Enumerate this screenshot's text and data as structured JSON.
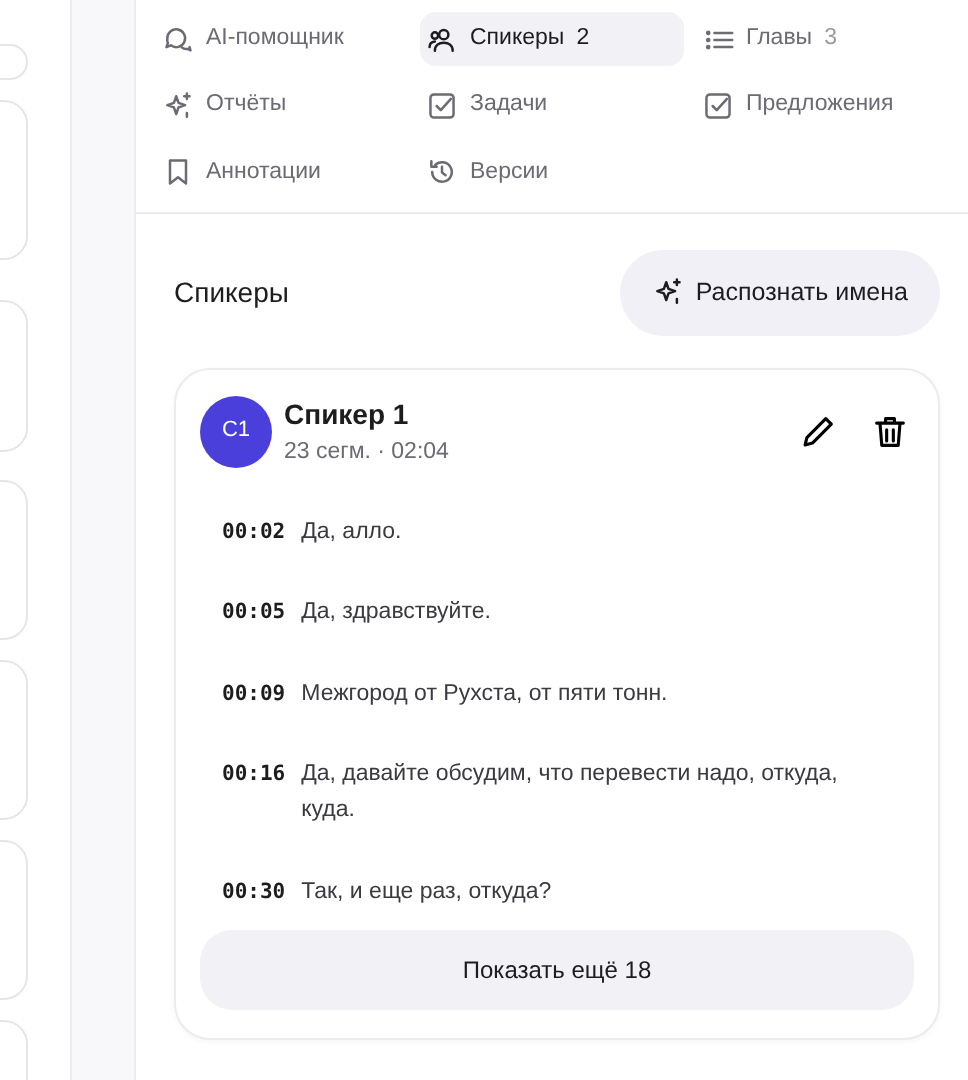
{
  "tabs": [
    {
      "label": "AI-помощник",
      "selected": false
    },
    {
      "label": "Спикеры",
      "count": "2",
      "selected": true
    },
    {
      "label": "Главы",
      "count": "3",
      "selected": false
    },
    {
      "label": "Отчёты",
      "selected": false
    },
    {
      "label": "Задачи",
      "selected": false
    },
    {
      "label": "Предложения",
      "selected": false
    },
    {
      "label": "Аннотации",
      "selected": false
    },
    {
      "label": "Версии",
      "selected": false
    }
  ],
  "section": {
    "title": "Спикеры",
    "action": "Распознать имена"
  },
  "speakers": [
    {
      "initials": "С1",
      "color": "#4b3fdc",
      "name": "Спикер 1",
      "meta": "23 сегм. · 02:04",
      "segments": [
        {
          "time": "00:02",
          "text": "Да, алло."
        },
        {
          "time": "00:05",
          "text": "Да, здравствуйте."
        },
        {
          "time": "00:09",
          "text": "Межгород от Рухста, от пяти тонн."
        },
        {
          "time": "00:16",
          "text": "Да, давайте обсудим, что перевести надо, откуда, куда."
        },
        {
          "time": "00:30",
          "text": "Так, и еще раз, откуда?"
        }
      ],
      "more": "Показать ещё 18"
    }
  ]
}
